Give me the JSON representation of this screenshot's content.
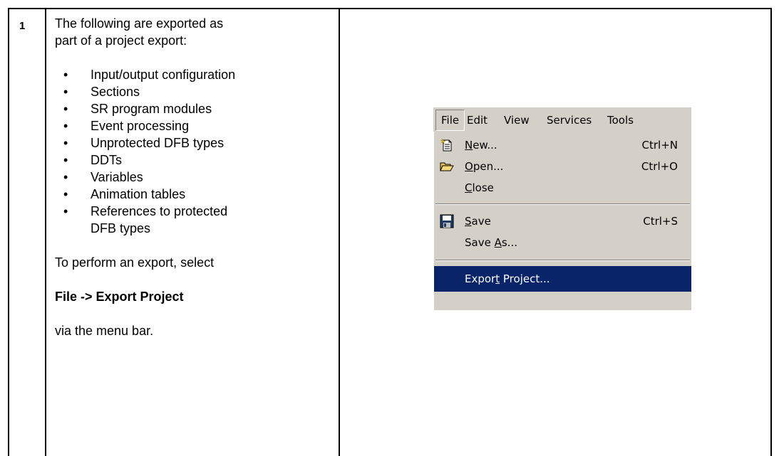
{
  "step": {
    "number": "1"
  },
  "instructions": {
    "intro_line1": "The following are exported as",
    "intro_line2": "part of a project export:",
    "bullets": [
      "Input/output configuration",
      "Sections",
      "SR program modules",
      "Event processing",
      "Unprotected DFB types",
      "DDTs",
      "Variables",
      "Animation tables",
      "References to protected",
      "DFB types"
    ],
    "perform": "To perform an export, select",
    "command": "File -> Export Project",
    "via": "via the menu bar."
  },
  "menu": {
    "bar": [
      "File",
      "Edit",
      "View",
      "Services",
      "Tools"
    ],
    "items": [
      {
        "label_pre": "",
        "label_u": "N",
        "label_post": "ew...",
        "shortcut": "Ctrl+N",
        "icon": "new-document-icon"
      },
      {
        "label_pre": "",
        "label_u": "O",
        "label_post": "pen...",
        "shortcut": "Ctrl+O",
        "icon": "open-folder-icon"
      },
      {
        "label_pre": "",
        "label_u": "C",
        "label_post": "lose",
        "shortcut": "",
        "icon": ""
      },
      {
        "label_pre": "",
        "label_u": "S",
        "label_post": "ave",
        "shortcut": "Ctrl+S",
        "icon": "save-disk-icon"
      },
      {
        "label_pre": "Save ",
        "label_u": "A",
        "label_post": "s...",
        "shortcut": "",
        "icon": ""
      },
      {
        "label_pre": "Expor",
        "label_u": "t",
        "label_post": " Project...",
        "shortcut": "",
        "icon": ""
      }
    ],
    "colors": {
      "menu_bg": "#d4d0c8",
      "highlight_bg": "#0a246a",
      "highlight_text": "#ffffff"
    }
  }
}
